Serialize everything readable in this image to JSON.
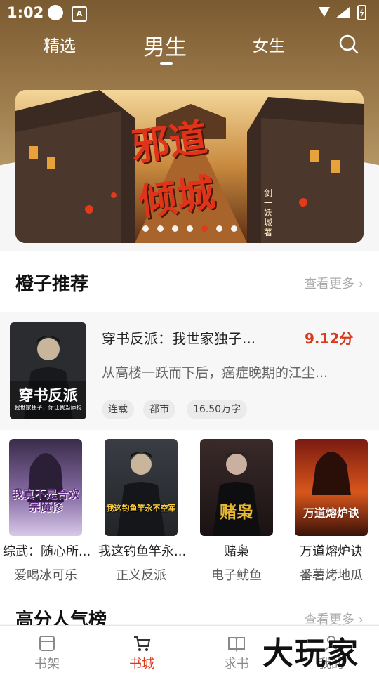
{
  "status": {
    "time": "1:02",
    "app_icon": "A"
  },
  "nav": {
    "tabs": [
      "精选",
      "男生",
      "女生"
    ],
    "active_index": 1
  },
  "banner": {
    "title_chars": [
      "邪",
      "道",
      "倾",
      "城"
    ],
    "author_text": "剑一妖城著",
    "dot_count": 7,
    "active_dot": 4
  },
  "section1": {
    "title": "橙子推荐",
    "more": "查看更多"
  },
  "featured": {
    "cover_text": "穿书反派",
    "cover_sub": "我世家独子，你让我当舔狗",
    "title": "穿书反派：我世家独子...",
    "score": "9.12分",
    "desc": "从高楼一跃而下后，癌症晚期的江尘...",
    "tags": [
      "连载",
      "都市",
      "16.50万字"
    ]
  },
  "books": [
    {
      "title": "综武：随心所...",
      "author": "爱喝冰可乐",
      "cover_text": "我真不是合欢宗魔修"
    },
    {
      "title": "我这钓鱼竿永...",
      "author": "正义反派",
      "cover_text": "我这钓鱼竿永不空军"
    },
    {
      "title": "赌枭",
      "author": "电子鱿鱼",
      "cover_text": "赌枭"
    },
    {
      "title": "万道熔炉诀",
      "author": "番薯烤地瓜",
      "cover_text": "万道熔炉诀"
    }
  ],
  "section2": {
    "title": "高分人气榜",
    "more": "查看更多"
  },
  "bottom_nav": [
    {
      "label": "书架",
      "icon": "bookshelf-icon"
    },
    {
      "label": "书城",
      "icon": "cart-icon"
    },
    {
      "label": "求书",
      "icon": "open-book-icon"
    },
    {
      "label": "我的",
      "icon": "person-icon"
    }
  ],
  "active_bottom": 1,
  "watermark": "大玩家",
  "colors": {
    "accent": "#d83a1e",
    "header": "#9c7a4b"
  }
}
